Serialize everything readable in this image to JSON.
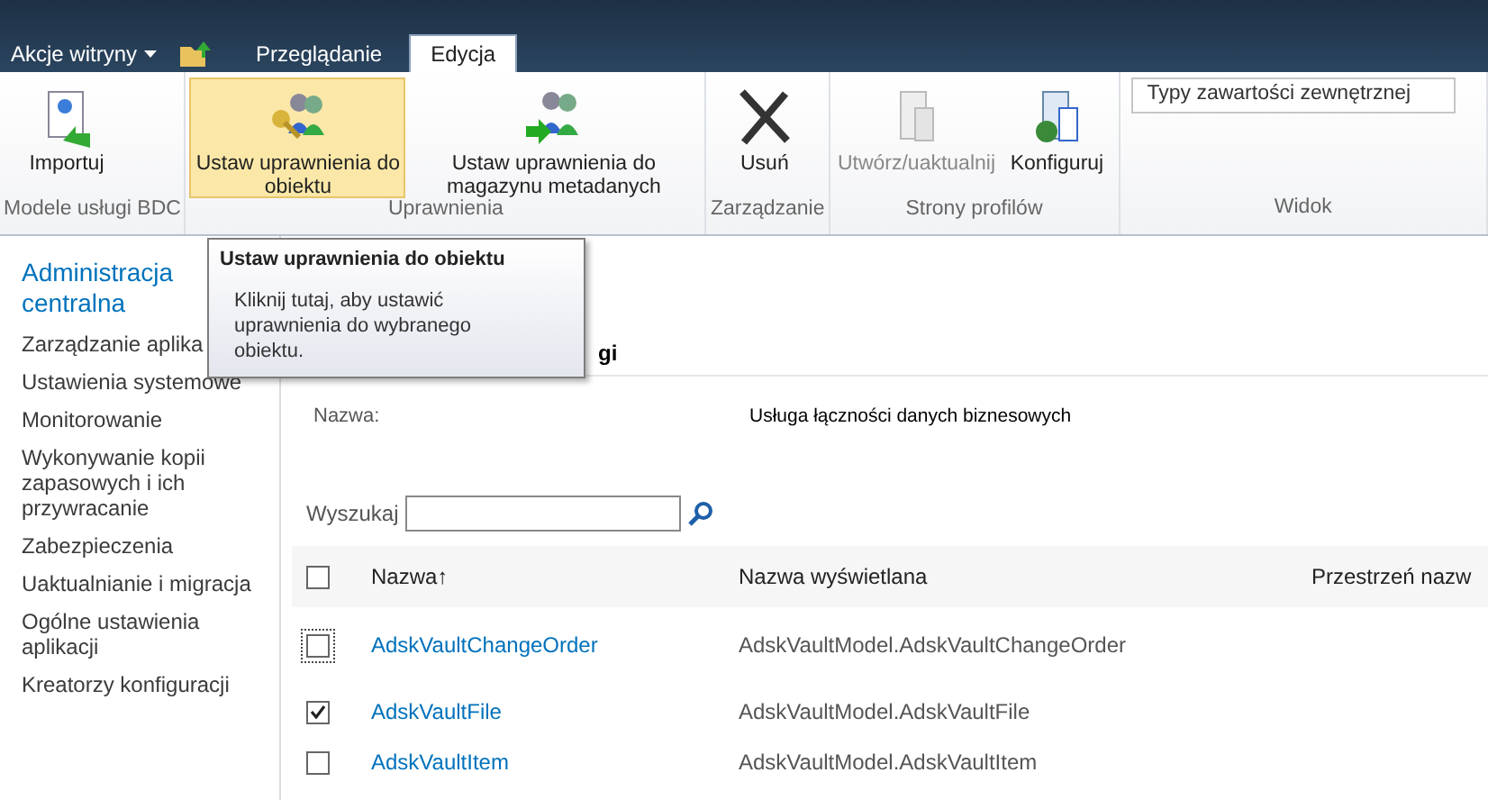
{
  "top_bar": {
    "site_actions": "Akcje witryny",
    "tabs": [
      {
        "label": "Przeglądanie",
        "selected": false
      },
      {
        "label": "Edycja",
        "selected": true
      }
    ]
  },
  "ribbon": {
    "groups": [
      {
        "label": "Modele usługi BDC",
        "buttons": [
          {
            "label": "Importuj",
            "hover": false,
            "disabled": false
          }
        ]
      },
      {
        "label": "Uprawnienia",
        "buttons": [
          {
            "label": "Ustaw uprawnienia do obiektu",
            "hover": true,
            "disabled": false
          },
          {
            "label": "Ustaw uprawnienia do magazynu metadanych",
            "hover": false,
            "disabled": false
          }
        ]
      },
      {
        "label": "Zarządzanie",
        "buttons": [
          {
            "label": "Usuń",
            "hover": false,
            "disabled": false
          }
        ]
      },
      {
        "label": "Strony profilów",
        "buttons": [
          {
            "label": "Utwórz/uaktualnij",
            "hover": false,
            "disabled": true
          },
          {
            "label": "Konfiguruj",
            "hover": false,
            "disabled": false
          }
        ]
      },
      {
        "label": "Widok",
        "view_select": "Typy zawartości zewnętrznej"
      }
    ]
  },
  "tooltip": {
    "title": "Ustaw uprawnienia do obiektu",
    "body": "Kliknij tutaj, aby ustawić uprawnienia do wybranego obiektu."
  },
  "sidebar": {
    "title": "Administracja centralna",
    "items": [
      "Zarządzanie aplika",
      "Ustawienia systemowe",
      "Monitorowanie",
      "Wykonywanie kopii zapasowych i ich przywracanie",
      "Zabezpieczenia",
      "Uaktualnianie i migracja",
      "Ogólne ustawienia aplikacji",
      "Kreatorzy konfiguracji"
    ]
  },
  "content": {
    "heading": "gi",
    "name_label": "Nazwa:",
    "name_value": "Usługa łączności danych biznesowych",
    "search_label": "Wyszukaj",
    "table": {
      "columns": [
        "Nazwa↑",
        "Nazwa wyświetlana",
        "Przestrzeń nazw"
      ],
      "all_checked": false,
      "rows": [
        {
          "name": "AdskVaultChangeOrder",
          "display": "AdskVaultModel.AdskVaultChangeOrder",
          "checked": false,
          "focused": true
        },
        {
          "name": "AdskVaultFile",
          "display": "AdskVaultModel.AdskVaultFile",
          "checked": true,
          "focused": false
        },
        {
          "name": "AdskVaultItem",
          "display": "AdskVaultModel.AdskVaultItem",
          "checked": false,
          "focused": false
        }
      ]
    }
  }
}
